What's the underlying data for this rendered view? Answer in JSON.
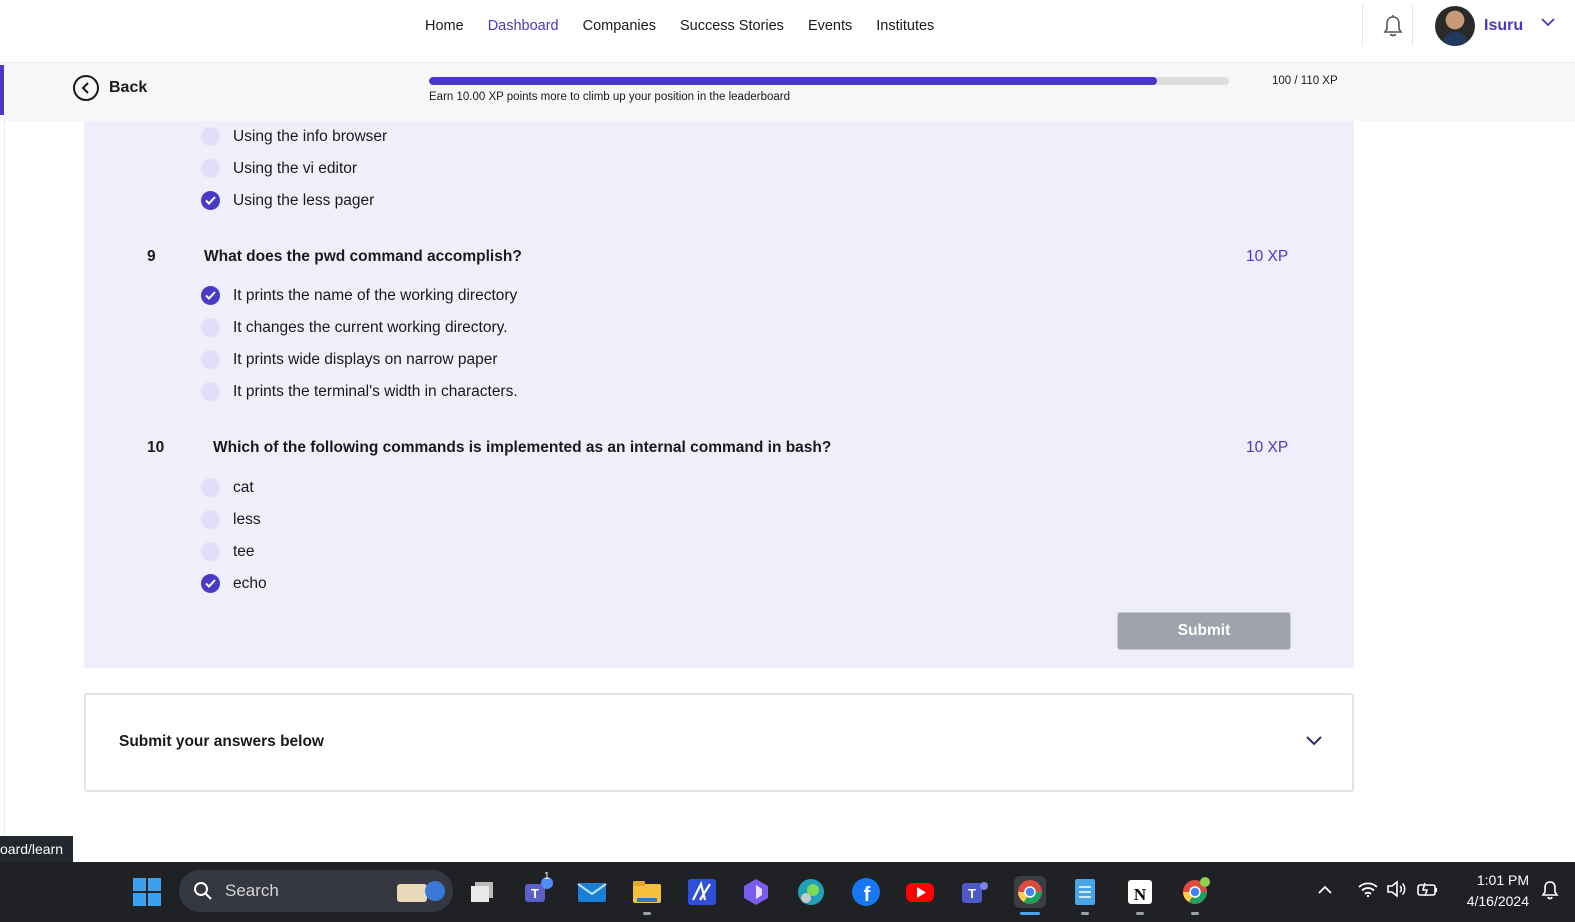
{
  "nav": {
    "links": [
      "Home",
      "Dashboard",
      "Companies",
      "Success Stories",
      "Events",
      "Institutes"
    ],
    "active": "Dashboard",
    "user_name": "Isuru",
    "icons": [
      "bell-icon",
      "chevron-down-icon"
    ]
  },
  "progress": {
    "back_label": "Back",
    "caption": "Earn 10.00 XP points more to climb up your position in the leaderboard",
    "readout": "100 / 110 XP",
    "fraction": 0.91
  },
  "questions": [
    {
      "number": "",
      "text": "",
      "xp": "",
      "options": [
        {
          "label": "Using the info browser",
          "checked": false
        },
        {
          "label": "Using the vi editor",
          "checked": false
        },
        {
          "label": "Using the less pager",
          "checked": true
        }
      ]
    },
    {
      "number": "9",
      "text": "What does the pwd command accomplish?",
      "xp": "10 XP",
      "options": [
        {
          "label": "It prints the name of the working directory",
          "checked": true
        },
        {
          "label": "It changes the current working directory.",
          "checked": false
        },
        {
          "label": "It prints wide displays on narrow paper",
          "checked": false
        },
        {
          "label": "It prints the terminal's width in characters.",
          "checked": false
        }
      ]
    },
    {
      "number": "10",
      "text": "Which of the following commands is implemented as an internal command in bash?",
      "xp": "10 XP",
      "options": [
        {
          "label": "cat",
          "checked": false
        },
        {
          "label": "less",
          "checked": false
        },
        {
          "label": "tee",
          "checked": false
        },
        {
          "label": "echo",
          "checked": true
        }
      ]
    }
  ],
  "submit_label": "Submit",
  "accordion_title": "Submit your answers below",
  "url_tooltip": "oard/learn",
  "taskbar": {
    "search_placeholder": "Search",
    "teams_badge": "1",
    "time": "1:01 PM",
    "date": "4/16/2024"
  },
  "colors": {
    "accent": "#4a38c7",
    "panel": "#f0eefb",
    "radio_unchecked": "#e2def6",
    "submit_disabled": "#9ea3ad"
  }
}
